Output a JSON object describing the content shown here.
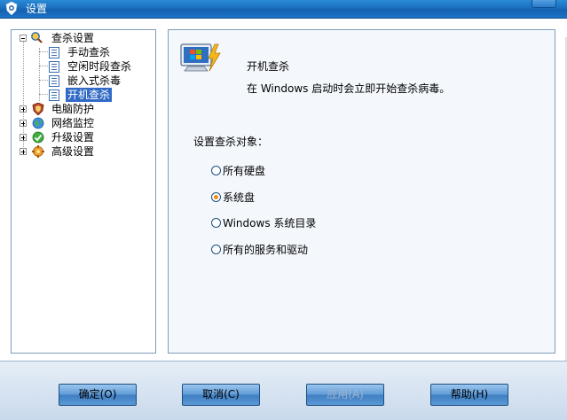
{
  "window": {
    "title": "设置"
  },
  "tree": {
    "items": [
      {
        "label": "查杀设置",
        "icon": "magnifier-icon"
      },
      {
        "label": "手动查杀",
        "icon": "document-icon"
      },
      {
        "label": "空闲时段查杀",
        "icon": "document-icon"
      },
      {
        "label": "嵌入式杀毒",
        "icon": "document-icon"
      },
      {
        "label": "开机查杀",
        "icon": "document-icon",
        "selected": true
      },
      {
        "label": "电脑防护",
        "icon": "shield-icon"
      },
      {
        "label": "网络监控",
        "icon": "globe-icon"
      },
      {
        "label": "升级设置",
        "icon": "update-icon"
      },
      {
        "label": "高级设置",
        "icon": "advanced-icon"
      }
    ]
  },
  "content": {
    "title": "开机查杀",
    "description": "在 Windows 启动时会立即开始查杀病毒。",
    "section_label": "设置查杀对象：",
    "options": [
      {
        "label": "所有硬盘",
        "checked": false
      },
      {
        "label": "系统盘",
        "checked": true
      },
      {
        "label": "Windows 系统目录",
        "checked": false
      },
      {
        "label": "所有的服务和驱动",
        "checked": false
      }
    ]
  },
  "buttons": {
    "ok": "确定(O)",
    "cancel": "取消(C)",
    "apply": "应用(A)",
    "help": "帮助(H)"
  },
  "colors": {
    "titlebar": "#1a6fbe",
    "selection": "#316ac5",
    "radio_dot": "#f48a1f",
    "button": "#5e9ad6"
  }
}
